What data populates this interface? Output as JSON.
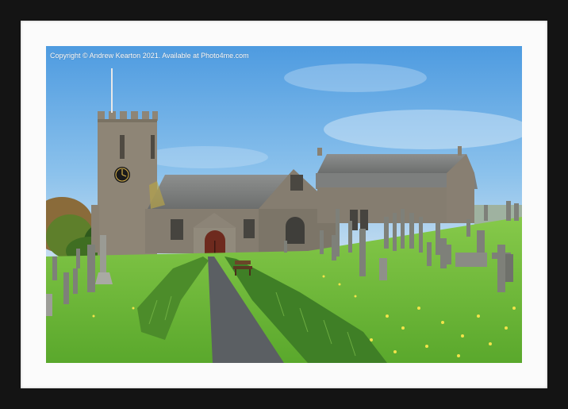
{
  "photo": {
    "copyright_text": "Copyright © Andrew Kearton 2021. Available at Photo4me.com",
    "subject": "church-with-graveyard",
    "colors": {
      "frame": "#141414",
      "mount": "#fbfbfb",
      "sky": "#6fb0e6",
      "grass": "#6fbf3a",
      "stone": "#8a8a84"
    }
  }
}
